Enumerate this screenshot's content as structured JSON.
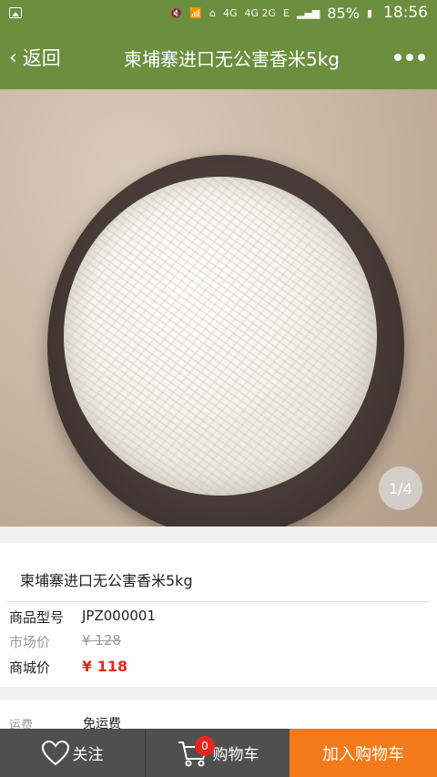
{
  "status_bar": {
    "network_4g": "4G",
    "network_4g_2g": "4G 2G",
    "signal_e": "E",
    "battery": "85%",
    "time": "18:56"
  },
  "nav": {
    "back_label": "返回",
    "title": "柬埔寨进口无公害香米5kg"
  },
  "gallery": {
    "pager": "1/4"
  },
  "product": {
    "name": "柬埔寨进口无公害香米5kg",
    "model_label": "商品型号",
    "model_value": "JPZ000001",
    "market_price_label": "市场价",
    "market_price_value": "¥ 128",
    "mall_price_label": "商城价",
    "mall_price_value": "¥ 118"
  },
  "shipping": {
    "label": "运费",
    "value": "免运费"
  },
  "bottom_bar": {
    "favorite_label": "关注",
    "cart_label": "购物车",
    "cart_count": "0",
    "add_to_cart_label": "加入购物车"
  }
}
